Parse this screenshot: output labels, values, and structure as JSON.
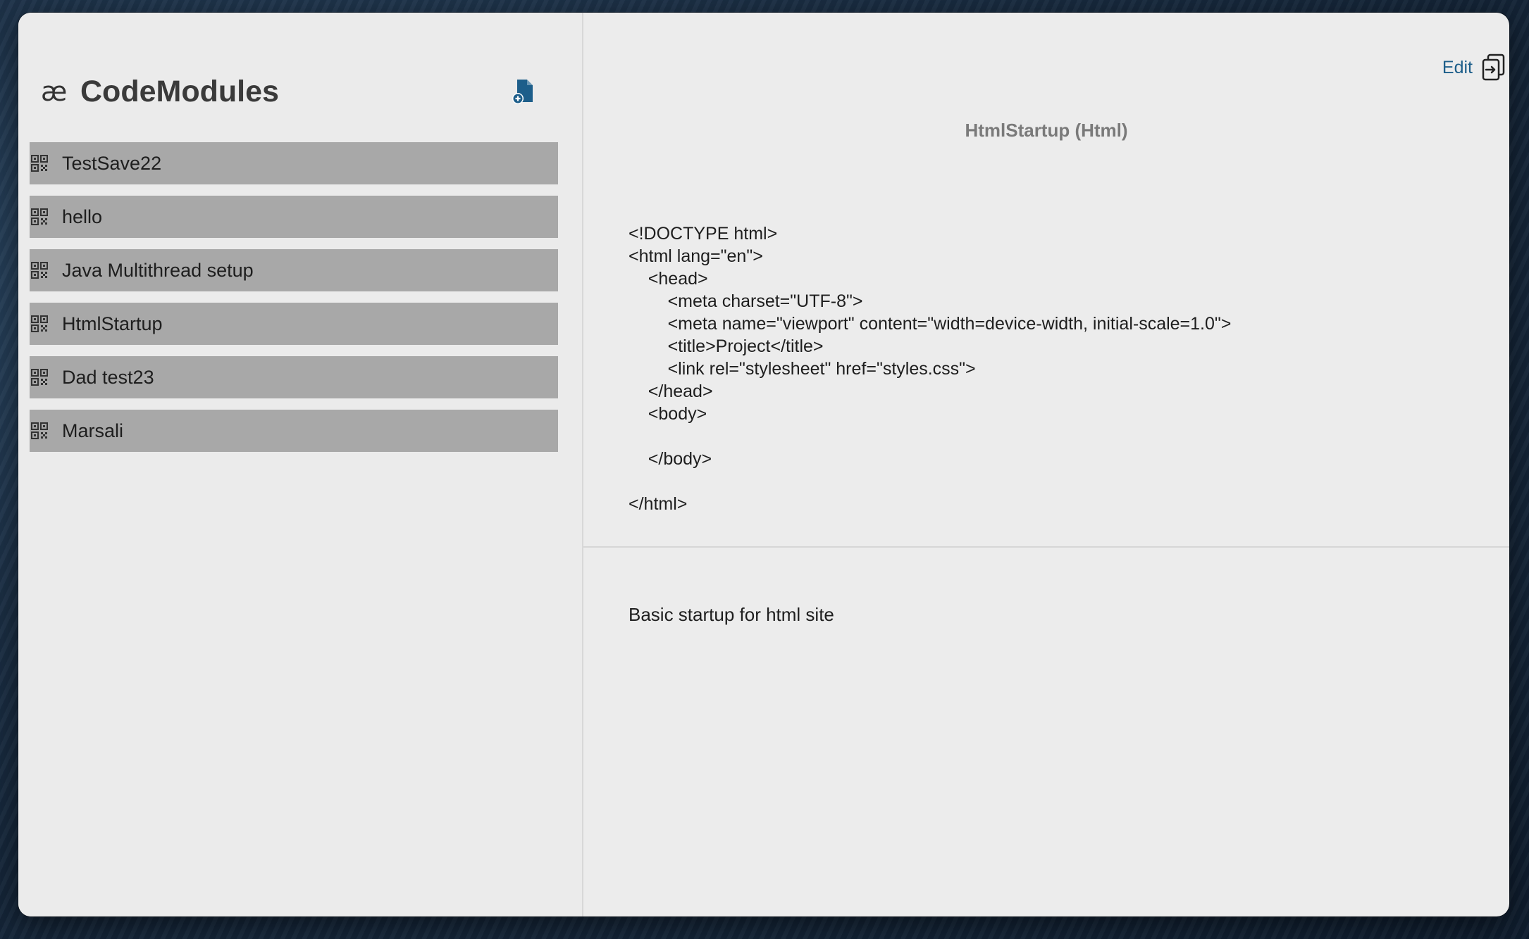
{
  "app": {
    "logo_glyph": "æ",
    "title": "CodeModules",
    "new_icon": "new-document-icon",
    "accent_color": "#1d5e8a"
  },
  "sidebar": {
    "items": [
      {
        "label": "TestSave22",
        "icon": "qr-code-icon"
      },
      {
        "label": "hello",
        "icon": "qr-code-icon"
      },
      {
        "label": "Java Multithread setup",
        "icon": "qr-code-icon"
      },
      {
        "label": "HtmlStartup",
        "icon": "qr-code-icon"
      },
      {
        "label": "Dad test23",
        "icon": "qr-code-icon"
      },
      {
        "label": "Marsali",
        "icon": "qr-code-icon"
      }
    ]
  },
  "main": {
    "edit_label": "Edit",
    "export_icon": "export-icon",
    "snippet_title": "HtmlStartup (Html)",
    "code": "<!DOCTYPE html>\n<html lang=\"en\">\n    <head>\n        <meta charset=\"UTF-8\">\n        <meta name=\"viewport\" content=\"width=device-width, initial-scale=1.0\">\n        <title>Project</title>\n        <link rel=\"stylesheet\" href=\"styles.css\">\n    </head>\n    <body>\n\n    </body>\n\n</html>",
    "description": "Basic startup for html site"
  }
}
